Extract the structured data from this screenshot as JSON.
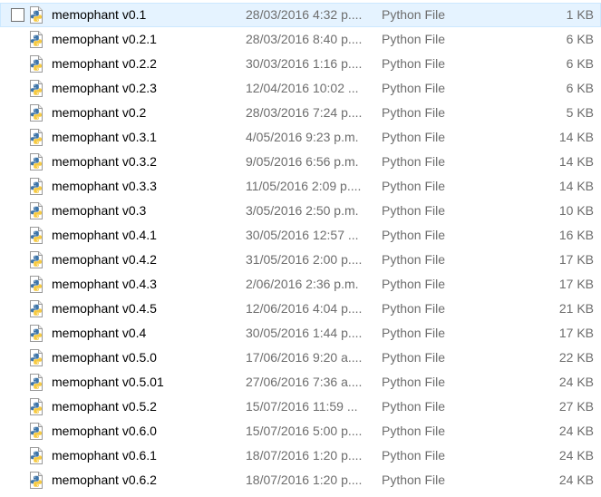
{
  "files": [
    {
      "name": "memophant v0.1",
      "date": "28/03/2016 4:32 p....",
      "type": "Python File",
      "size": "1 KB",
      "hover": true
    },
    {
      "name": "memophant v0.2.1",
      "date": "28/03/2016 8:40 p....",
      "type": "Python File",
      "size": "6 KB"
    },
    {
      "name": "memophant v0.2.2",
      "date": "30/03/2016 1:16 p....",
      "type": "Python File",
      "size": "6 KB"
    },
    {
      "name": "memophant v0.2.3",
      "date": "12/04/2016 10:02 ...",
      "type": "Python File",
      "size": "6 KB"
    },
    {
      "name": "memophant v0.2",
      "date": "28/03/2016 7:24 p....",
      "type": "Python File",
      "size": "5 KB"
    },
    {
      "name": "memophant v0.3.1",
      "date": "4/05/2016 9:23 p.m.",
      "type": "Python File",
      "size": "14 KB"
    },
    {
      "name": "memophant v0.3.2",
      "date": "9/05/2016 6:56 p.m.",
      "type": "Python File",
      "size": "14 KB"
    },
    {
      "name": "memophant v0.3.3",
      "date": "11/05/2016 2:09 p....",
      "type": "Python File",
      "size": "14 KB"
    },
    {
      "name": "memophant v0.3",
      "date": "3/05/2016 2:50 p.m.",
      "type": "Python File",
      "size": "10 KB"
    },
    {
      "name": "memophant v0.4.1",
      "date": "30/05/2016 12:57 ...",
      "type": "Python File",
      "size": "16 KB"
    },
    {
      "name": "memophant v0.4.2",
      "date": "31/05/2016 2:00 p....",
      "type": "Python File",
      "size": "17 KB"
    },
    {
      "name": "memophant v0.4.3",
      "date": "2/06/2016 2:36 p.m.",
      "type": "Python File",
      "size": "17 KB"
    },
    {
      "name": "memophant v0.4.5",
      "date": "12/06/2016 4:04 p....",
      "type": "Python File",
      "size": "21 KB"
    },
    {
      "name": "memophant v0.4",
      "date": "30/05/2016 1:44 p....",
      "type": "Python File",
      "size": "17 KB"
    },
    {
      "name": "memophant v0.5.0",
      "date": "17/06/2016 9:20 a....",
      "type": "Python File",
      "size": "22 KB"
    },
    {
      "name": "memophant v0.5.01",
      "date": "27/06/2016 7:36 a....",
      "type": "Python File",
      "size": "24 KB"
    },
    {
      "name": "memophant v0.5.2",
      "date": "15/07/2016 11:59 ...",
      "type": "Python File",
      "size": "27 KB"
    },
    {
      "name": "memophant v0.6.0",
      "date": "15/07/2016 5:00 p....",
      "type": "Python File",
      "size": "24 KB"
    },
    {
      "name": "memophant v0.6.1",
      "date": "18/07/2016 1:20 p....",
      "type": "Python File",
      "size": "24 KB"
    },
    {
      "name": "memophant v0.6.2",
      "date": "18/07/2016 1:20 p....",
      "type": "Python File",
      "size": "24 KB"
    }
  ],
  "icons": {
    "file": "python-file-icon",
    "checkbox": "checkbox-icon"
  },
  "colors": {
    "hover_background": "#e5f3ff",
    "hover_border": "#cce8ff",
    "python_blue": "#3d74a8",
    "python_yellow": "#f6c93f",
    "secondary_text": "#6d6d6d"
  }
}
